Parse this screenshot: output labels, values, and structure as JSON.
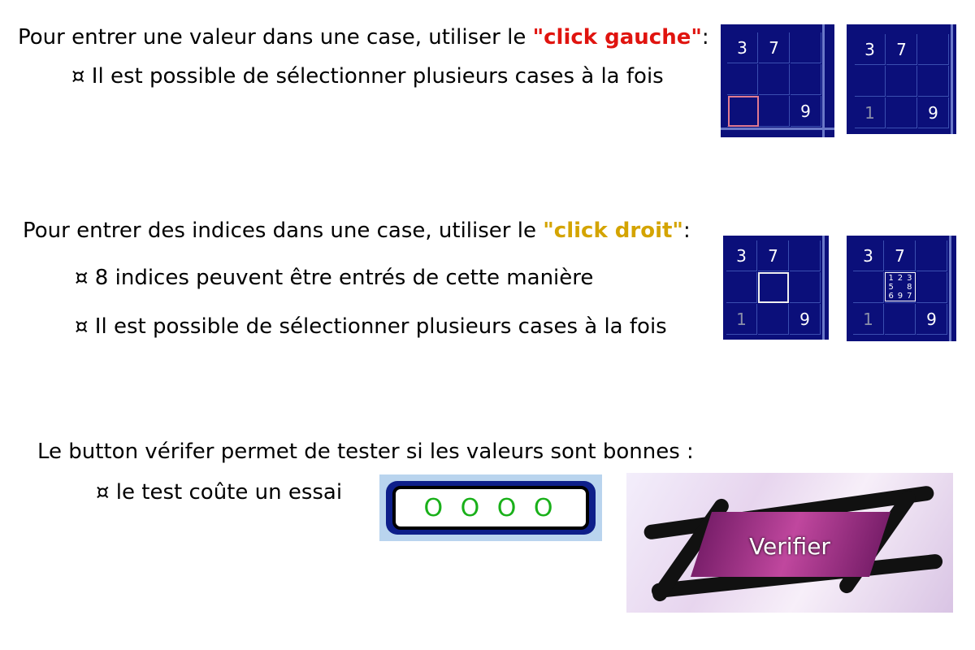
{
  "section1": {
    "line1_prefix": "Pour entrer une valeur dans une case, utiliser le ",
    "line1_highlight": "\"click gauche\"",
    "line1_suffix": ":",
    "bullet1": "¤ Il est possible de sélectionner plusieurs cases à la fois",
    "grid_a": {
      "r1c1": "3",
      "r1c2": "7",
      "r3c3": "9"
    },
    "grid_b": {
      "r1c1": "3",
      "r1c2": "7",
      "r3c1": "1",
      "r3c3": "9"
    }
  },
  "section2": {
    "line_prefix": "Pour entrer des indices dans une case, utiliser le ",
    "line_highlight": "\"click droit\"",
    "line_suffix": ":",
    "bullet1": "¤ 8 indices peuvent être entrés de cette manière",
    "bullet2": "¤ Il est possible de sélectionner plusieurs cases à la fois",
    "grid_c": {
      "r1c1": "3",
      "r1c2": "7",
      "r3c1": "1",
      "r3c3": "9"
    },
    "grid_d": {
      "r1c1": "3",
      "r1c2": "7",
      "r3c1": "1",
      "r3c3": "9",
      "hints": [
        "1",
        "2",
        "3",
        "5",
        "",
        "8",
        "6",
        "9",
        "7"
      ]
    }
  },
  "section3": {
    "line": "Le button vérifer permet de tester si les valeurs sont bonnes :",
    "bullet1": "¤ le test coûte un essai",
    "counter_value": "O O O O",
    "verify_label": "Verifier"
  },
  "colors": {
    "grid_bg": "#0b0f7a",
    "left_click": "#e0140f",
    "right_click": "#d4a400",
    "counter_text": "#19b019"
  }
}
